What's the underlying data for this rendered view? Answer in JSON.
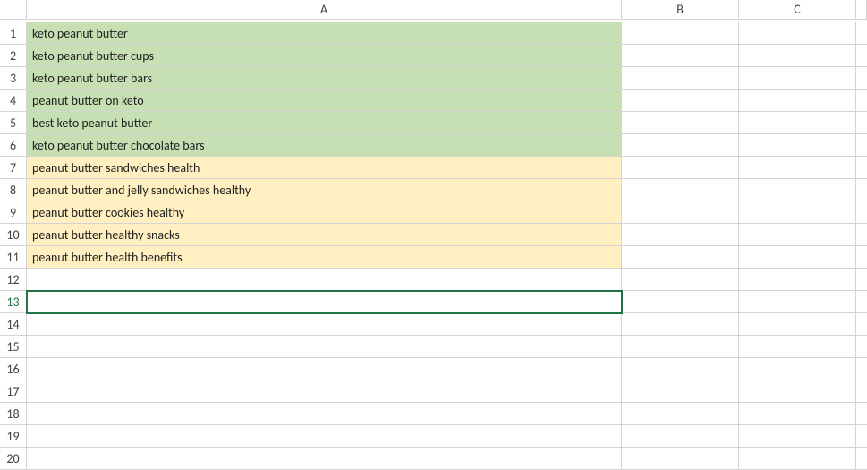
{
  "columns": [
    "A",
    "B",
    "C"
  ],
  "rows": [
    {
      "num": "1",
      "a": "keto peanut butter",
      "bg": "green"
    },
    {
      "num": "2",
      "a": "keto peanut butter cups",
      "bg": "green"
    },
    {
      "num": "3",
      "a": "keto peanut butter bars",
      "bg": "green"
    },
    {
      "num": "4",
      "a": "peanut butter on keto",
      "bg": "green"
    },
    {
      "num": "5",
      "a": "best keto peanut butter",
      "bg": "green"
    },
    {
      "num": "6",
      "a": "keto peanut butter chocolate bars",
      "bg": "green"
    },
    {
      "num": "7",
      "a": "peanut butter sandwiches health",
      "bg": "yellow"
    },
    {
      "num": "8",
      "a": "peanut butter and jelly sandwiches healthy",
      "bg": "yellow"
    },
    {
      "num": "9",
      "a": "peanut butter cookies healthy",
      "bg": "yellow"
    },
    {
      "num": "10",
      "a": "peanut butter healthy snacks",
      "bg": "yellow"
    },
    {
      "num": "11",
      "a": "peanut butter health benefits",
      "bg": "yellow"
    },
    {
      "num": "12",
      "a": "",
      "bg": ""
    },
    {
      "num": "13",
      "a": "",
      "bg": "",
      "active": true
    },
    {
      "num": "14",
      "a": "",
      "bg": ""
    },
    {
      "num": "15",
      "a": "",
      "bg": ""
    },
    {
      "num": "16",
      "a": "",
      "bg": ""
    },
    {
      "num": "17",
      "a": "",
      "bg": ""
    },
    {
      "num": "18",
      "a": "",
      "bg": ""
    },
    {
      "num": "19",
      "a": "",
      "bg": ""
    },
    {
      "num": "20",
      "a": "",
      "bg": ""
    }
  ]
}
